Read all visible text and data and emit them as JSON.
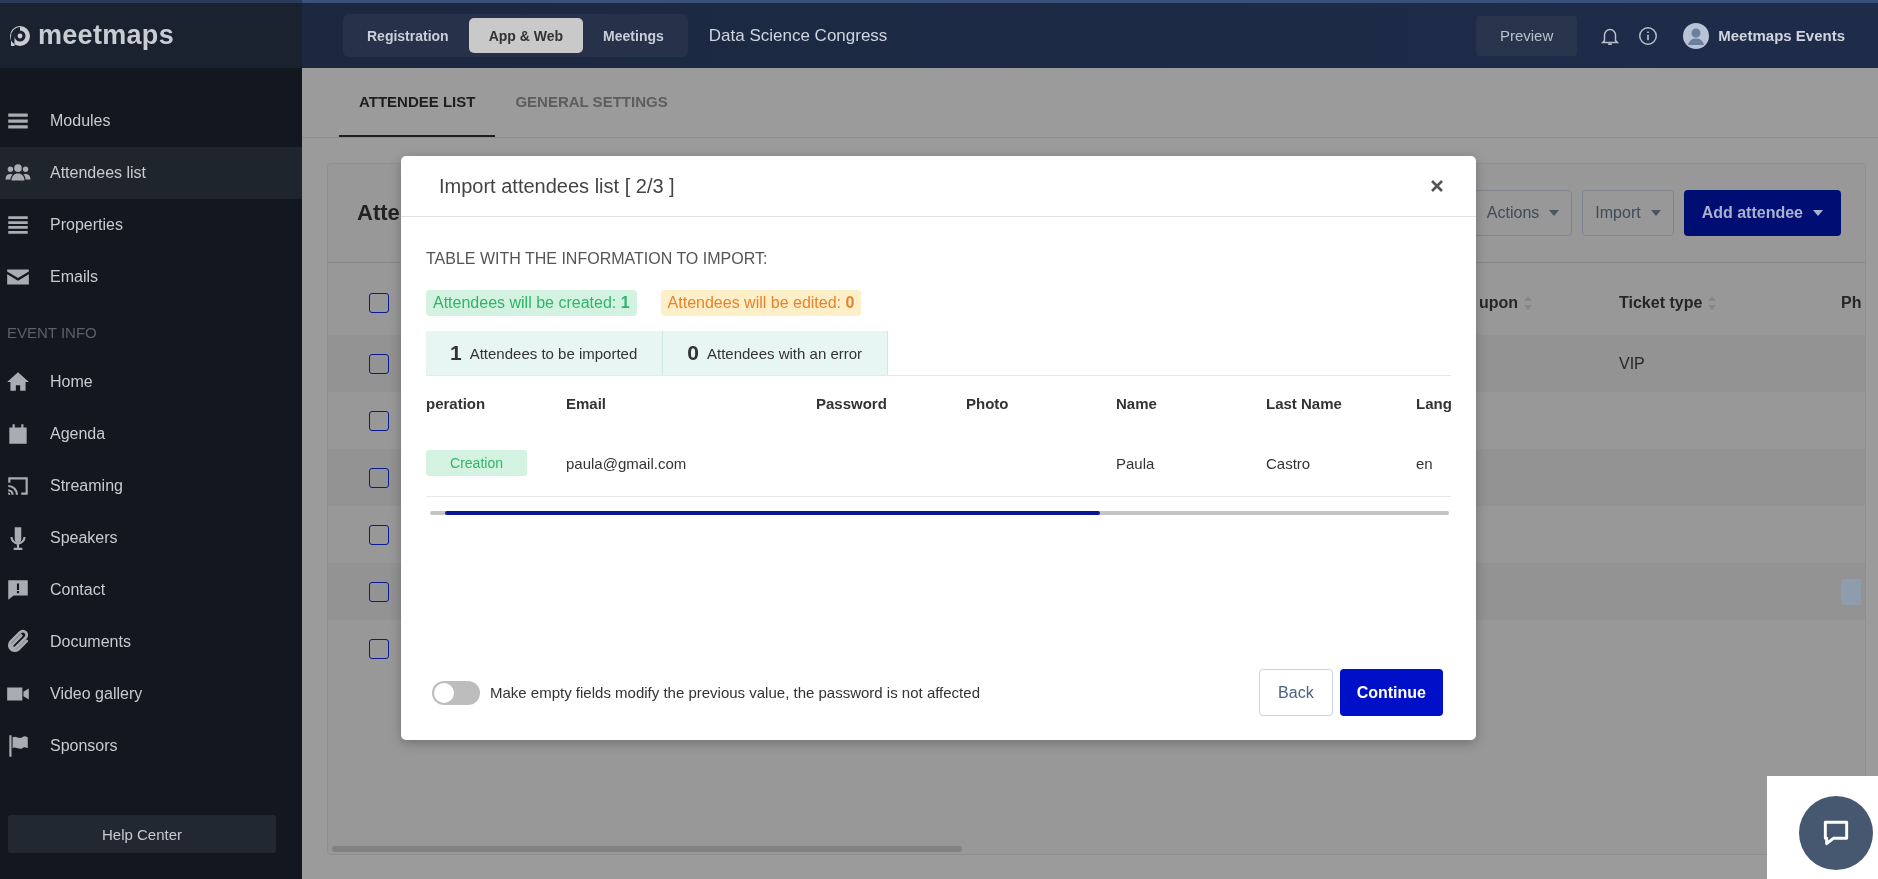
{
  "sidebar": {
    "logo": "meetmaps",
    "items": [
      {
        "label": "Modules",
        "selected": false
      },
      {
        "label": "Attendees list",
        "selected": true
      },
      {
        "label": "Properties",
        "selected": false
      },
      {
        "label": "Emails",
        "selected": false
      }
    ],
    "event_info": {
      "heading": "EVENT INFO",
      "items": [
        {
          "label": "Home",
          "selected": false
        },
        {
          "label": "Agenda",
          "selected": false
        },
        {
          "label": "Streaming",
          "selected": false
        },
        {
          "label": "Speakers",
          "selected": false
        },
        {
          "label": "Contact",
          "selected": false
        },
        {
          "label": "Documents",
          "selected": false
        },
        {
          "label": "Video gallery",
          "selected": false
        },
        {
          "label": "Sponsors",
          "selected": false
        }
      ]
    },
    "help_button": "Help Center"
  },
  "topbar": {
    "tabs": [
      {
        "label": "Registration",
        "selected": false
      },
      {
        "label": "App & Web",
        "selected": true
      },
      {
        "label": "Meetings",
        "selected": false
      }
    ],
    "event_title": "Data Science Congress",
    "preview_button": "Preview",
    "user_name": "Meetmaps Events"
  },
  "page_tabs": [
    {
      "label": "ATTENDEE LIST",
      "selected": true
    },
    {
      "label": "GENERAL SETTINGS",
      "selected": false
    }
  ],
  "card": {
    "title": "Atte",
    "buttons": [
      {
        "label": "Actions",
        "primary": false
      },
      {
        "label": "Import",
        "primary": false
      },
      {
        "label": "Add attendee",
        "primary": true
      }
    ],
    "table": {
      "header_checked": false,
      "columns": [
        "upon",
        "Ticket type",
        "Ph"
      ],
      "rows": [
        {
          "checked": false,
          "ticket_type": "VIP",
          "chip": false
        },
        {
          "checked": false,
          "chip": false
        },
        {
          "checked": false,
          "chip": false
        },
        {
          "checked": false,
          "chip": false
        },
        {
          "checked": false,
          "chip": true
        },
        {
          "checked": false,
          "chip": false
        }
      ]
    }
  },
  "modal": {
    "title": "Import attendees list [ 2/3 ]",
    "section_title": "TABLE WITH THE INFORMATION TO IMPORT:",
    "badges": [
      {
        "kind": "created",
        "text": "Attendees will be created: **1**"
      },
      {
        "kind": "edited",
        "text": "Attendees will be edited: **0**"
      }
    ],
    "stats": [
      {
        "count": "1",
        "label": "Attendees to be imported"
      },
      {
        "count": "0",
        "label": "Attendees with an error"
      }
    ],
    "table": {
      "columns": [
        "peration",
        "Email",
        "Password",
        "Photo",
        "Name",
        "Last Name",
        "Lang"
      ],
      "rows": [
        {
          "operation": "Creation",
          "email": "paula@gmail.com",
          "name": "Paula",
          "last_name": "Castro",
          "language": "en"
        }
      ]
    },
    "toggle": {
      "on": false,
      "label": "Make empty fields modify the previous value, the password is not affected"
    },
    "back_button": "Back",
    "continue_button": "Continue"
  }
}
